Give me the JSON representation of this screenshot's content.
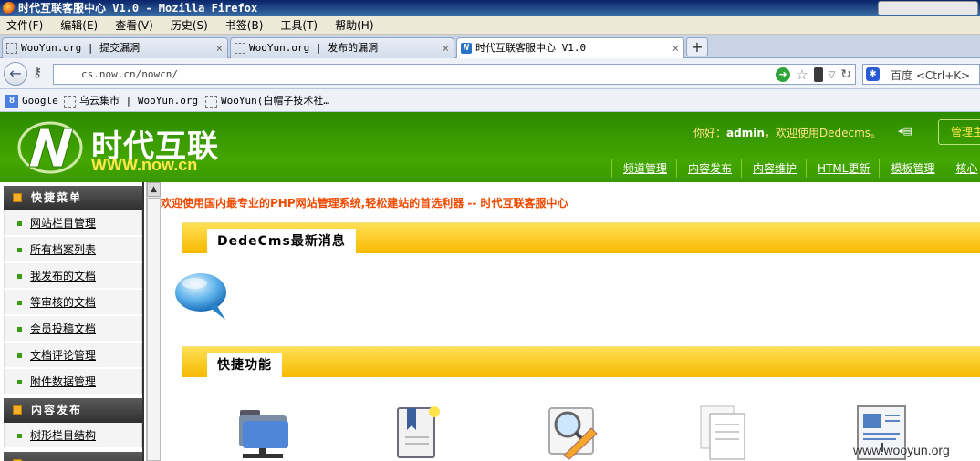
{
  "window": {
    "title": "时代互联客服中心 V1.0 - Mozilla Firefox"
  },
  "menu": [
    "文件(F)",
    "编辑(E)",
    "查看(V)",
    "历史(S)",
    "书签(B)",
    "工具(T)",
    "帮助(H)"
  ],
  "tabs": [
    {
      "label": "WooYun.org | 提交漏洞",
      "close": "×"
    },
    {
      "label": "WooYun.org | 发布的漏洞",
      "close": "×"
    },
    {
      "label": "时代互联客服中心 V1.0",
      "close": "×"
    }
  ],
  "new_tab": "+",
  "nav": {
    "url": "cs.now.cn/nowcn/",
    "search_placeholder": "百度 <Ctrl+K>"
  },
  "bookmarks": [
    "Google",
    "乌云集市 | WooYun.org",
    "WooYun(白帽子技术社…"
  ],
  "site": {
    "logo_cn": "时代互联",
    "logo_en": "WWW.now.cn",
    "welcome_prefix": "你好：",
    "welcome_user": "admin",
    "welcome_suffix": "，欢迎使用Dedecms。",
    "manage_button": "管理主",
    "nav_links": [
      "频道管理",
      "内容发布",
      "内容维护",
      "HTML更新",
      "模板管理",
      "核心"
    ]
  },
  "sidebar": {
    "sections": [
      {
        "title": "快捷菜单",
        "items": [
          "网站栏目管理",
          "所有档案列表",
          "我发布的文档",
          "等审核的文档",
          "会员投稿文档",
          "文档评论管理",
          "附件数据管理"
        ]
      },
      {
        "title": "内容发布",
        "items": [
          "树形栏目结构"
        ]
      }
    ]
  },
  "main": {
    "marquee": "欢迎使用国内最专业的PHP网站管理系统,轻松建站的首选利器 -- 时代互联客服中心",
    "news_title": "DedeCms最新消息",
    "quick_title": "快捷功能"
  },
  "watermark": "www.wooyun.org",
  "colors": {
    "header_green": "#44a700",
    "band_yellow": "#f7b900",
    "marquee_orange": "#f04a00"
  }
}
